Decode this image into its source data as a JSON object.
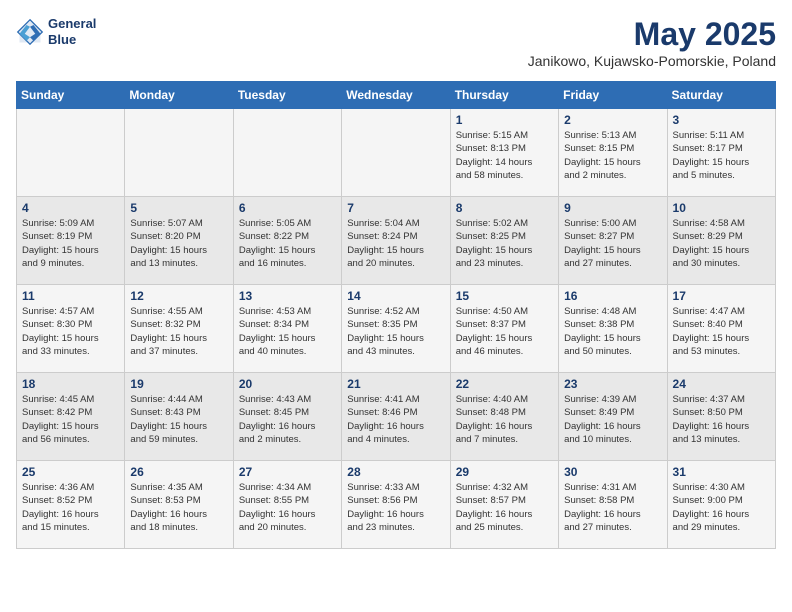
{
  "header": {
    "logo_line1": "General",
    "logo_line2": "Blue",
    "month_year": "May 2025",
    "location": "Janikowo, Kujawsko-Pomorskie, Poland"
  },
  "weekdays": [
    "Sunday",
    "Monday",
    "Tuesday",
    "Wednesday",
    "Thursday",
    "Friday",
    "Saturday"
  ],
  "weeks": [
    [
      {
        "day": "",
        "info": ""
      },
      {
        "day": "",
        "info": ""
      },
      {
        "day": "",
        "info": ""
      },
      {
        "day": "",
        "info": ""
      },
      {
        "day": "1",
        "info": "Sunrise: 5:15 AM\nSunset: 8:13 PM\nDaylight: 14 hours\nand 58 minutes."
      },
      {
        "day": "2",
        "info": "Sunrise: 5:13 AM\nSunset: 8:15 PM\nDaylight: 15 hours\nand 2 minutes."
      },
      {
        "day": "3",
        "info": "Sunrise: 5:11 AM\nSunset: 8:17 PM\nDaylight: 15 hours\nand 5 minutes."
      }
    ],
    [
      {
        "day": "4",
        "info": "Sunrise: 5:09 AM\nSunset: 8:19 PM\nDaylight: 15 hours\nand 9 minutes."
      },
      {
        "day": "5",
        "info": "Sunrise: 5:07 AM\nSunset: 8:20 PM\nDaylight: 15 hours\nand 13 minutes."
      },
      {
        "day": "6",
        "info": "Sunrise: 5:05 AM\nSunset: 8:22 PM\nDaylight: 15 hours\nand 16 minutes."
      },
      {
        "day": "7",
        "info": "Sunrise: 5:04 AM\nSunset: 8:24 PM\nDaylight: 15 hours\nand 20 minutes."
      },
      {
        "day": "8",
        "info": "Sunrise: 5:02 AM\nSunset: 8:25 PM\nDaylight: 15 hours\nand 23 minutes."
      },
      {
        "day": "9",
        "info": "Sunrise: 5:00 AM\nSunset: 8:27 PM\nDaylight: 15 hours\nand 27 minutes."
      },
      {
        "day": "10",
        "info": "Sunrise: 4:58 AM\nSunset: 8:29 PM\nDaylight: 15 hours\nand 30 minutes."
      }
    ],
    [
      {
        "day": "11",
        "info": "Sunrise: 4:57 AM\nSunset: 8:30 PM\nDaylight: 15 hours\nand 33 minutes."
      },
      {
        "day": "12",
        "info": "Sunrise: 4:55 AM\nSunset: 8:32 PM\nDaylight: 15 hours\nand 37 minutes."
      },
      {
        "day": "13",
        "info": "Sunrise: 4:53 AM\nSunset: 8:34 PM\nDaylight: 15 hours\nand 40 minutes."
      },
      {
        "day": "14",
        "info": "Sunrise: 4:52 AM\nSunset: 8:35 PM\nDaylight: 15 hours\nand 43 minutes."
      },
      {
        "day": "15",
        "info": "Sunrise: 4:50 AM\nSunset: 8:37 PM\nDaylight: 15 hours\nand 46 minutes."
      },
      {
        "day": "16",
        "info": "Sunrise: 4:48 AM\nSunset: 8:38 PM\nDaylight: 15 hours\nand 50 minutes."
      },
      {
        "day": "17",
        "info": "Sunrise: 4:47 AM\nSunset: 8:40 PM\nDaylight: 15 hours\nand 53 minutes."
      }
    ],
    [
      {
        "day": "18",
        "info": "Sunrise: 4:45 AM\nSunset: 8:42 PM\nDaylight: 15 hours\nand 56 minutes."
      },
      {
        "day": "19",
        "info": "Sunrise: 4:44 AM\nSunset: 8:43 PM\nDaylight: 15 hours\nand 59 minutes."
      },
      {
        "day": "20",
        "info": "Sunrise: 4:43 AM\nSunset: 8:45 PM\nDaylight: 16 hours\nand 2 minutes."
      },
      {
        "day": "21",
        "info": "Sunrise: 4:41 AM\nSunset: 8:46 PM\nDaylight: 16 hours\nand 4 minutes."
      },
      {
        "day": "22",
        "info": "Sunrise: 4:40 AM\nSunset: 8:48 PM\nDaylight: 16 hours\nand 7 minutes."
      },
      {
        "day": "23",
        "info": "Sunrise: 4:39 AM\nSunset: 8:49 PM\nDaylight: 16 hours\nand 10 minutes."
      },
      {
        "day": "24",
        "info": "Sunrise: 4:37 AM\nSunset: 8:50 PM\nDaylight: 16 hours\nand 13 minutes."
      }
    ],
    [
      {
        "day": "25",
        "info": "Sunrise: 4:36 AM\nSunset: 8:52 PM\nDaylight: 16 hours\nand 15 minutes."
      },
      {
        "day": "26",
        "info": "Sunrise: 4:35 AM\nSunset: 8:53 PM\nDaylight: 16 hours\nand 18 minutes."
      },
      {
        "day": "27",
        "info": "Sunrise: 4:34 AM\nSunset: 8:55 PM\nDaylight: 16 hours\nand 20 minutes."
      },
      {
        "day": "28",
        "info": "Sunrise: 4:33 AM\nSunset: 8:56 PM\nDaylight: 16 hours\nand 23 minutes."
      },
      {
        "day": "29",
        "info": "Sunrise: 4:32 AM\nSunset: 8:57 PM\nDaylight: 16 hours\nand 25 minutes."
      },
      {
        "day": "30",
        "info": "Sunrise: 4:31 AM\nSunset: 8:58 PM\nDaylight: 16 hours\nand 27 minutes."
      },
      {
        "day": "31",
        "info": "Sunrise: 4:30 AM\nSunset: 9:00 PM\nDaylight: 16 hours\nand 29 minutes."
      }
    ]
  ]
}
